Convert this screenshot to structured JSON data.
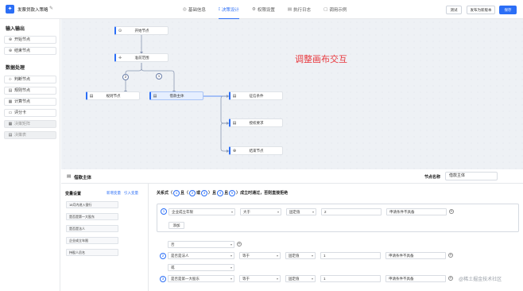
{
  "app": {
    "title": "发票贷款入策略",
    "logo_glyph": "✦",
    "edit_icon": "edit-icon",
    "edit_glyph": "✎"
  },
  "tabs": [
    {
      "label": "基础信息",
      "icon": "◎",
      "active": false
    },
    {
      "label": "决策设计",
      "icon": "⟟",
      "active": true
    },
    {
      "label": "权限设置",
      "icon": "⚙",
      "active": false
    },
    {
      "label": "执行日志",
      "icon": "▤",
      "active": false
    },
    {
      "label": "调用示例",
      "icon": "▢",
      "active": false
    }
  ],
  "header_buttons": {
    "test": "测试",
    "publish": "发布为新版本",
    "save": "保存"
  },
  "sidebar": {
    "io_title": "输入输出",
    "io_items": [
      {
        "label": "开始节点",
        "icon": "⊕"
      },
      {
        "label": "结束节点",
        "icon": "⊕"
      }
    ],
    "data_title": "数据处理",
    "data_items": [
      {
        "label": "判断节点",
        "icon": "⊹",
        "disabled": false
      },
      {
        "label": "规则节点",
        "icon": "▤",
        "disabled": false
      },
      {
        "label": "计算节点",
        "icon": "▦",
        "disabled": false
      },
      {
        "label": "评分卡",
        "icon": "▭",
        "disabled": false
      },
      {
        "label": "决策矩阵",
        "icon": "▦",
        "disabled": true
      },
      {
        "label": "决策表",
        "icon": "▤",
        "disabled": true
      }
    ]
  },
  "canvas": {
    "note": "调整画布交互",
    "nodes": {
      "start": {
        "label": "开始节点",
        "icon": "⊙"
      },
      "judge": {
        "label": "准前范围",
        "icon": "✛"
      },
      "rule_left": {
        "label": "规则节点",
        "icon": "▤"
      },
      "loan_subject": {
        "label": "借款主体",
        "icon": "▤"
      },
      "risk_cond": {
        "label": "征信条件",
        "icon": "▤"
      },
      "credit_req": {
        "label": "授权要求",
        "icon": "▤"
      },
      "end": {
        "label": "结束节点",
        "icon": "⊕"
      }
    },
    "badges": {
      "left": "2",
      "right": "1"
    }
  },
  "panel": {
    "title": "借款主体",
    "node_name_label": "节点名称",
    "node_name_value": "借款主体"
  },
  "variables": {
    "title": "变量设置",
    "new_label": "新增变量",
    "import_label": "引入变量",
    "items": [
      "18月内进入银行",
      "是否是第一大股东",
      "是否是法人",
      "企业成立年限",
      "持股人员名"
    ]
  },
  "rules": {
    "relation": {
      "prefix": "关系式（",
      "n1": "1",
      "and1": "且（",
      "n2": "2",
      "or": "或",
      "n3": "3",
      "and2": "）且",
      "n4": "4",
      "and3": "且",
      "n5": "5",
      "suffix": "）成立时通过，否则直接拒绝"
    },
    "group1": {
      "num": "1",
      "field": "企业成立年限",
      "op": "大于",
      "type": "固定值",
      "value": "2",
      "action": "申请条件不具备",
      "add_label": "添加"
    },
    "logic_or": "否",
    "row2": {
      "num": "2",
      "field": "是否是法人",
      "op": "等于",
      "type": "固定值",
      "value": "1",
      "action": "申请条件不具备"
    },
    "logic_or2": "或",
    "row3": {
      "num": "3",
      "field": "是否是第一大股东",
      "op": "等于",
      "type": "固定值",
      "value": "1",
      "action": "申请条件不具备"
    }
  },
  "watermark": "@稀土掘金技术社区",
  "colors": {
    "accent": "#2b6ef6",
    "note_red": "#e8383d",
    "canvas_bg": "#eef1f5"
  }
}
